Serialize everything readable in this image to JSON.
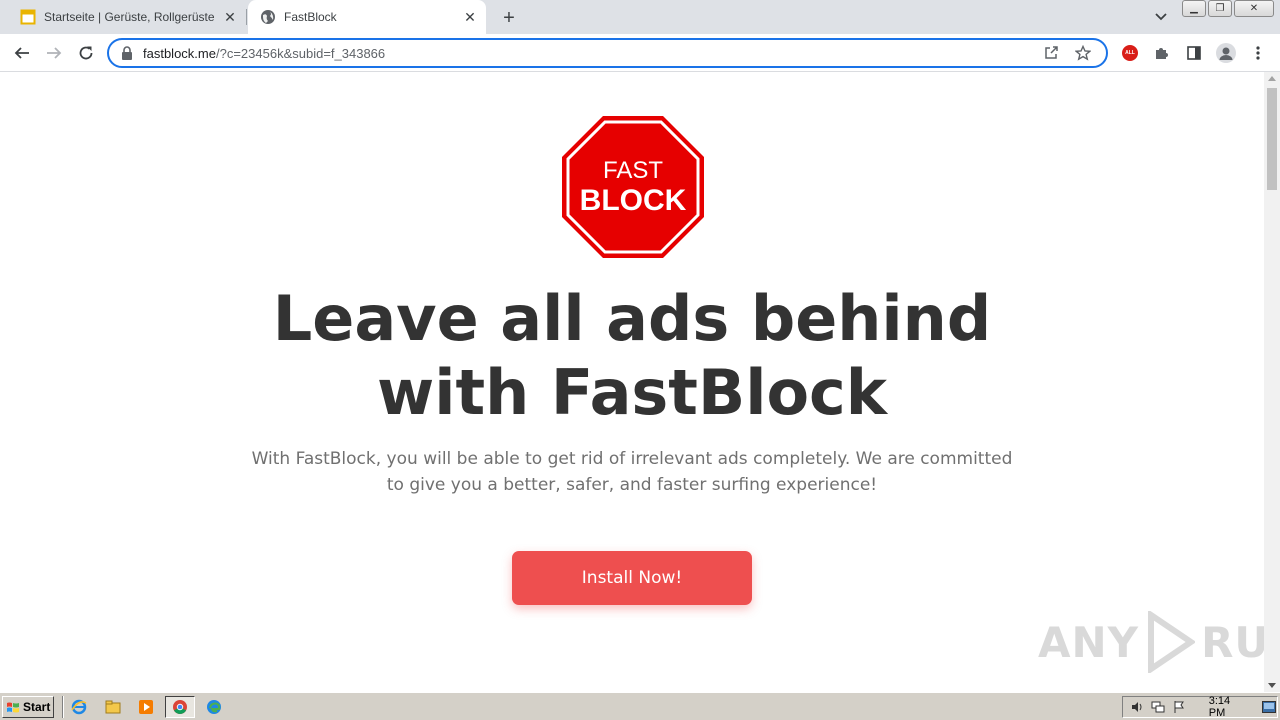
{
  "browser": {
    "tabs": [
      {
        "title": "Startseite | Gerüste, Rollgerüste, Fa",
        "active": false
      },
      {
        "title": "FastBlock",
        "active": true
      }
    ],
    "address": {
      "host": "fastblock.me",
      "path": "/?c=23456k&subid=f_343866"
    },
    "extension_badge": "ALL"
  },
  "page": {
    "logo": {
      "line1": "FAST",
      "line2": "BLOCK",
      "color": "#e60000"
    },
    "headline_line1": "Leave all ads behind",
    "headline_line2": "with FastBlock",
    "subtext_line1": "With FastBlock, you will be able to get rid of irrelevant ads completely. We are committed",
    "subtext_line2": "to give you a better, safer, and faster surfing experience!",
    "cta_label": "Install Now!",
    "cta_color": "#ee4f4f"
  },
  "watermark": {
    "left": "ANY",
    "right": "RUN"
  },
  "taskbar": {
    "start_label": "Start",
    "clock": "3:14 PM"
  }
}
